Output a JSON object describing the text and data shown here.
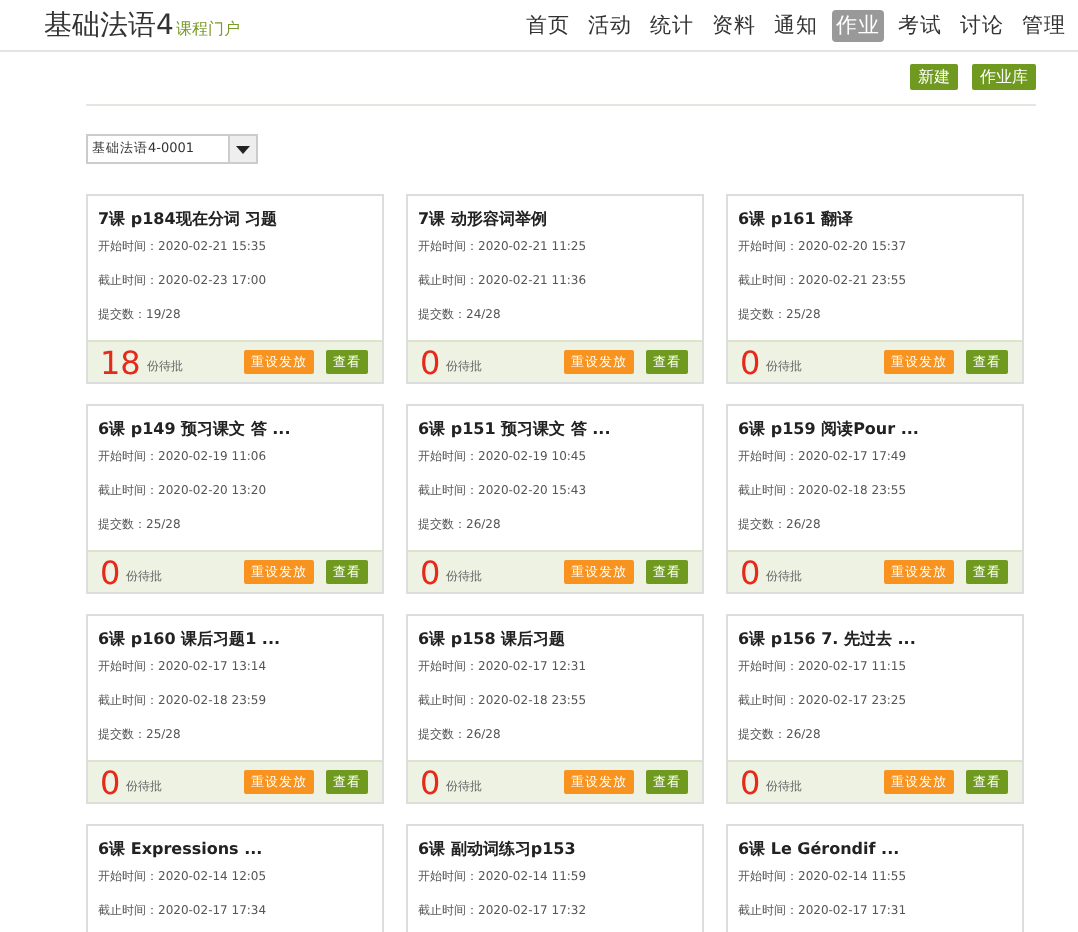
{
  "header": {
    "title": "基础法语4",
    "subtitle": "课程门户"
  },
  "nav": [
    {
      "label": "首页",
      "selected": false
    },
    {
      "label": "活动",
      "selected": false
    },
    {
      "label": "统计",
      "selected": false
    },
    {
      "label": "资料",
      "selected": false
    },
    {
      "label": "通知",
      "selected": false
    },
    {
      "label": "作业",
      "selected": true
    },
    {
      "label": "考试",
      "selected": false
    },
    {
      "label": "讨论",
      "selected": false
    },
    {
      "label": "管理",
      "selected": false
    }
  ],
  "actions": [
    "新建",
    "作业库"
  ],
  "class_select": {
    "value": "基础法语4-0001"
  },
  "assignments": [
    {
      "title": "7课 p184现在分词 习题",
      "fields": [
        "开始时间：2020-02-21 15:35",
        "截止时间：2020-02-23 17:00",
        "提交数：19/28"
      ],
      "pending": "18",
      "pending_label": "份待批",
      "buttons": [
        "重设发放",
        "查看"
      ]
    },
    {
      "title": "7课 动形容词举例",
      "fields": [
        "开始时间：2020-02-21 11:25",
        "截止时间：2020-02-21 11:36",
        "提交数：24/28"
      ],
      "pending": "0",
      "pending_label": "份待批",
      "buttons": [
        "重设发放",
        "查看"
      ]
    },
    {
      "title": "6课 p161 翻译",
      "fields": [
        "开始时间：2020-02-20 15:37",
        "截止时间：2020-02-21 23:55",
        "提交数：25/28"
      ],
      "pending": "0",
      "pending_label": "份待批",
      "buttons": [
        "重设发放",
        "查看"
      ]
    },
    {
      "title": "6课 p149 预习课文 答 ...",
      "fields": [
        "开始时间：2020-02-19 11:06",
        "截止时间：2020-02-20 13:20",
        "提交数：25/28"
      ],
      "pending": "0",
      "pending_label": "份待批",
      "buttons": [
        "重设发放",
        "查看"
      ]
    },
    {
      "title": "6课 p151 预习课文 答 ...",
      "fields": [
        "开始时间：2020-02-19 10:45",
        "截止时间：2020-02-20 15:43",
        "提交数：26/28"
      ],
      "pending": "0",
      "pending_label": "份待批",
      "buttons": [
        "重设发放",
        "查看"
      ]
    },
    {
      "title": "6课 p159 阅读Pour ...",
      "fields": [
        "开始时间：2020-02-17 17:49",
        "截止时间：2020-02-18 23:55",
        "提交数：26/28"
      ],
      "pending": "0",
      "pending_label": "份待批",
      "buttons": [
        "重设发放",
        "查看"
      ]
    },
    {
      "title": "6课 p160 课后习题1 ...",
      "fields": [
        "开始时间：2020-02-17 13:14",
        "截止时间：2020-02-18 23:59",
        "提交数：25/28"
      ],
      "pending": "0",
      "pending_label": "份待批",
      "buttons": [
        "重设发放",
        "查看"
      ]
    },
    {
      "title": "6课 p158 课后习题",
      "fields": [
        "开始时间：2020-02-17 12:31",
        "截止时间：2020-02-18 23:55",
        "提交数：26/28"
      ],
      "pending": "0",
      "pending_label": "份待批",
      "buttons": [
        "重设发放",
        "查看"
      ]
    },
    {
      "title": "6课 p156 7. 先过去 ...",
      "fields": [
        "开始时间：2020-02-17 11:15",
        "截止时间：2020-02-17 23:25",
        "提交数：26/28"
      ],
      "pending": "0",
      "pending_label": "份待批",
      "buttons": [
        "重设发放",
        "查看"
      ]
    },
    {
      "title": "6课 Expressions ...",
      "fields": [
        "开始时间：2020-02-14 12:05",
        "截止时间：2020-02-17 17:34"
      ]
    },
    {
      "title": "6课 副动词练习p153",
      "fields": [
        "开始时间：2020-02-14 11:59",
        "截止时间：2020-02-17 17:32"
      ]
    },
    {
      "title": "6课 Le Gérondif ...",
      "fields": [
        "开始时间：2020-02-14 11:55",
        "截止时间：2020-02-17 17:31"
      ]
    }
  ]
}
